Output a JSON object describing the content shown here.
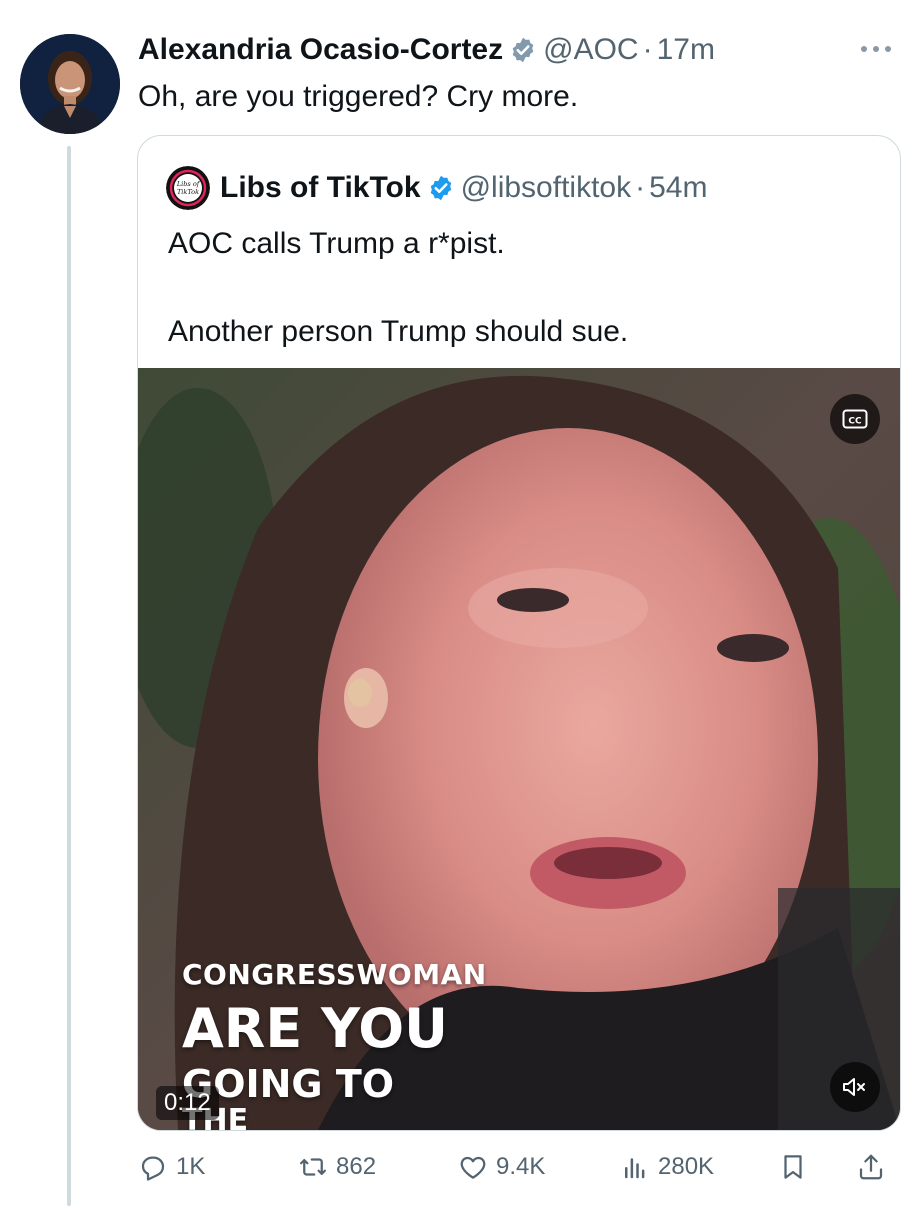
{
  "tweet": {
    "author_name": "Alexandria Ocasio-Cortez",
    "handle": "@AOC",
    "separator": "·",
    "time": "17m",
    "text": "Oh, are you triggered? Cry more.",
    "more_icon": "more-horizontal-icon",
    "verified_color": "#829aab"
  },
  "quoted_tweet": {
    "author_name": "Libs of TikTok",
    "handle": "@libsoftiktok",
    "separator": "·",
    "time": "54m",
    "text": "AOC calls Trump a r*pist.\n\nAnother person Trump should sue.",
    "verified_color": "#1d9bf0",
    "avatar_text": "Libs of TikTok"
  },
  "video": {
    "caption_lines": [
      "CONGRESSWOMAN",
      "ARE YOU",
      "GOING TO",
      "THE"
    ],
    "elapsed": "0:12",
    "cc_icon": "closed-captions-icon",
    "mute_icon": "volume-muted-icon"
  },
  "actions": {
    "replies": "1K",
    "reposts": "862",
    "likes": "9.4K",
    "views": "280K"
  },
  "colors": {
    "text_primary": "#0f1419",
    "text_secondary": "#536471",
    "border": "#cfd9de"
  }
}
